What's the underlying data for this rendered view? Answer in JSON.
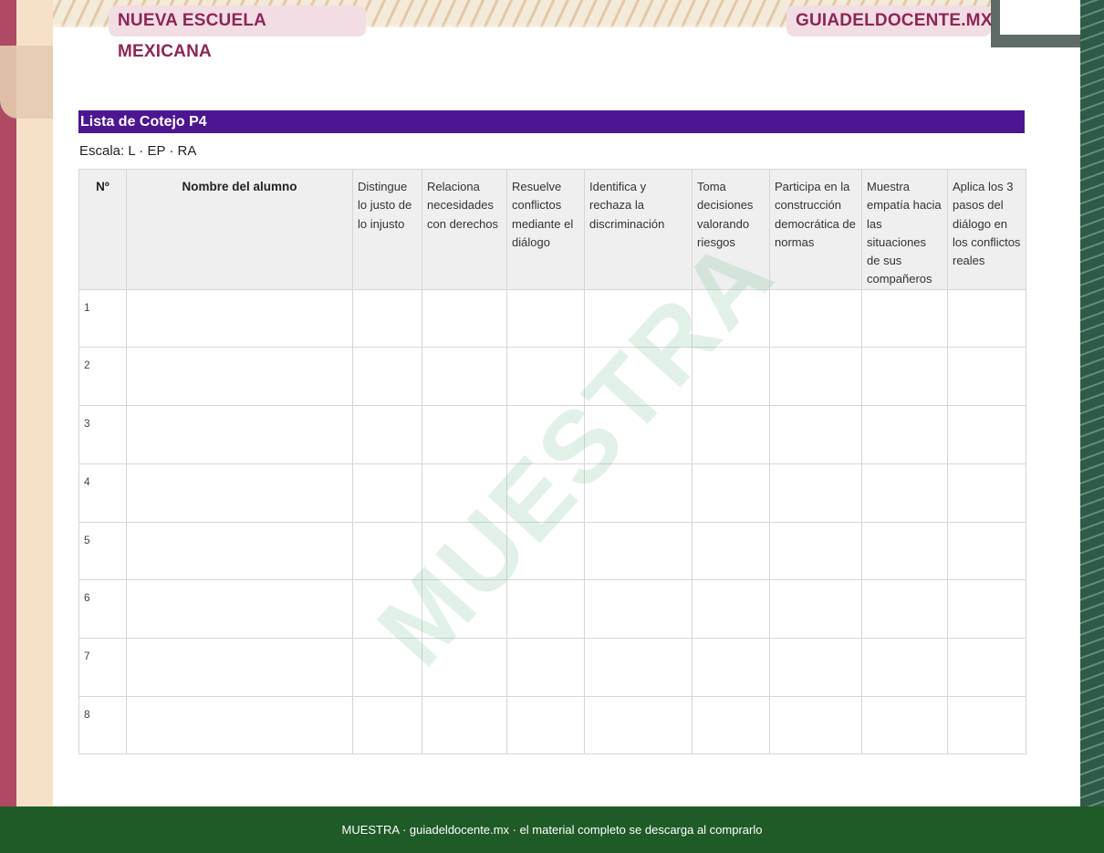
{
  "header": {
    "left_badge": "NUEVA ESCUELA MEXICANA",
    "right_badge": "GUIADELDOCENTE.MX",
    "accent": "#8c2754"
  },
  "section": {
    "title": "Lista de Cotejo P4",
    "scale": "Escala: L · EP · RA",
    "title_color": "#4b1690"
  },
  "table": {
    "headers": [
      "Nº",
      "Nombre del alumno",
      "Distingue lo justo de lo injusto",
      "Relaciona necesidades con derechos",
      "Resuelve conflictos mediante el diálogo",
      "Identifica y rechaza la discriminación",
      "Toma decisiones valorando riesgos",
      "Participa en la construcción democrática de normas",
      "Muestra empatía hacia las situaciones de sus compañeros",
      "Aplica los 3 pasos del diálogo en los conflictos reales"
    ],
    "rows": [
      "1",
      "2",
      "3",
      "4",
      "5",
      "6",
      "7",
      "8"
    ]
  },
  "watermark": "MUESTRA",
  "footer": {
    "text": "MUESTRA · guiadeldocente.mx · el material completo se descarga al comprarlo",
    "color": "#1f5b27"
  }
}
